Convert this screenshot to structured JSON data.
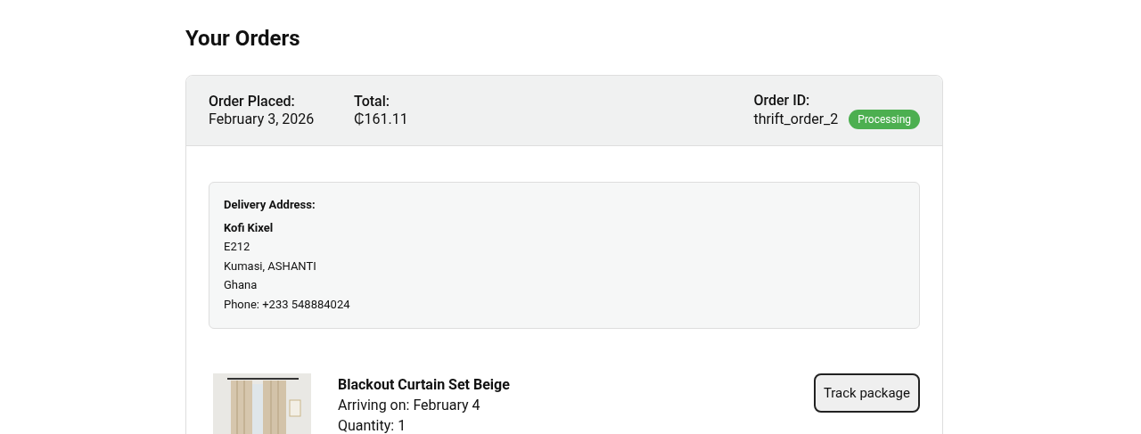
{
  "page_title": "Your Orders",
  "order": {
    "placed_label": "Order Placed:",
    "placed_value": "February 3, 2026",
    "total_label": "Total:",
    "total_value": "₵161.11",
    "id_label": "Order ID:",
    "id_value": "thrift_order_2",
    "status": "Processing",
    "address": {
      "heading": "Delivery Address:",
      "name": "Kofi Kixel",
      "lines": [
        "E212",
        "Kumasi, ASHANTI",
        "Ghana",
        "Phone: +233 548884024"
      ]
    },
    "items": [
      {
        "title": "Blackout Curtain Set Beige",
        "arriving": "Arriving on: February 4",
        "quantity": "Quantity: 1",
        "button": "Track package"
      }
    ]
  }
}
